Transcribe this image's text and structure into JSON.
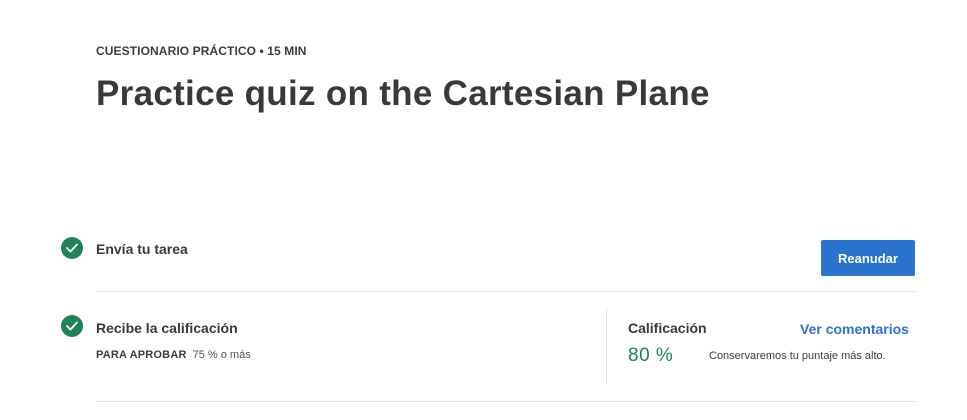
{
  "header": {
    "eyebrow": "CUESTIONARIO PRÁCTICO • 15 MIN",
    "title": "Practice quiz on the Cartesian Plane"
  },
  "steps": [
    {
      "title": "Envía tu tarea",
      "status": "completed",
      "icon": "check-circle-icon",
      "action_label": "Reanudar"
    },
    {
      "title": "Recibe la calificación",
      "status": "completed",
      "icon": "check-circle-icon",
      "pass_label": "PARA APROBAR",
      "pass_value": "75 % o más"
    }
  ],
  "grade": {
    "label": "Calificación",
    "value": "80 %",
    "feedback_link": "Ver comentarios",
    "note": "Conservaremos tu puntaje más alto."
  },
  "colors": {
    "success": "#1f8354",
    "primary": "#2a73cc",
    "text": "#373a3c",
    "divider": "#e1e1e1"
  }
}
